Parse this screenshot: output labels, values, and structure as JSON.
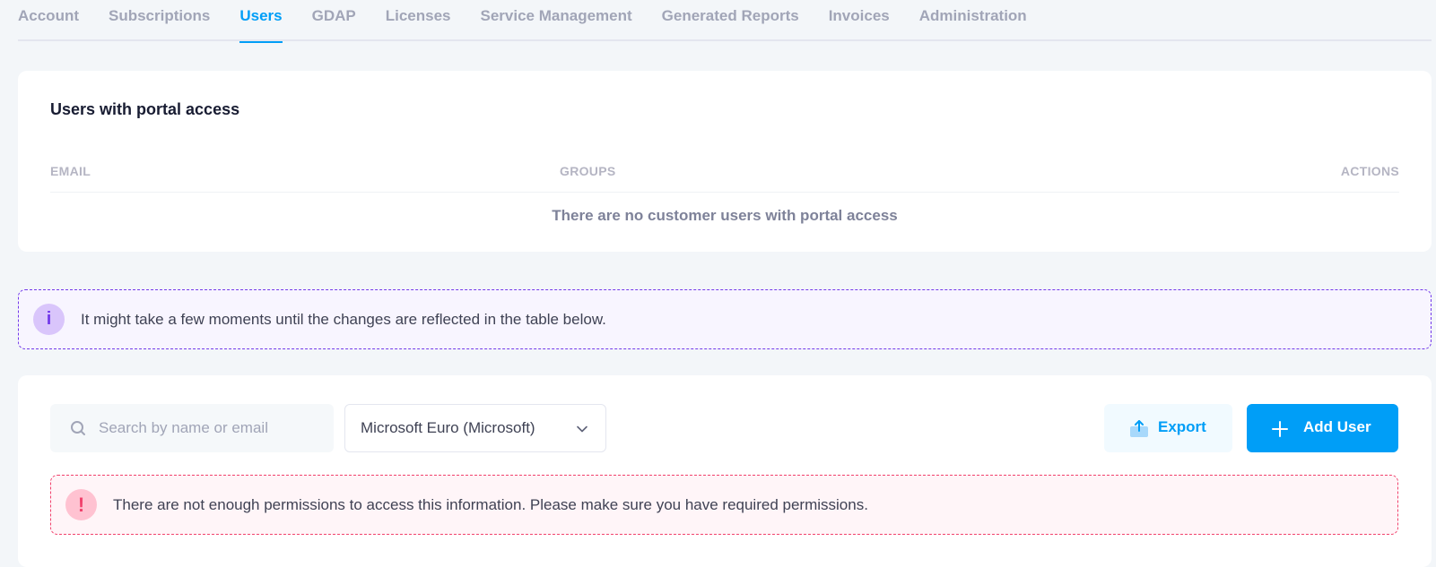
{
  "tabs": [
    {
      "label": "Account",
      "active": false
    },
    {
      "label": "Subscriptions",
      "active": false
    },
    {
      "label": "Users",
      "active": true
    },
    {
      "label": "GDAP",
      "active": false
    },
    {
      "label": "Licenses",
      "active": false
    },
    {
      "label": "Service Management",
      "active": false
    },
    {
      "label": "Generated Reports",
      "active": false
    },
    {
      "label": "Invoices",
      "active": false
    },
    {
      "label": "Administration",
      "active": false
    }
  ],
  "portal_users": {
    "title": "Users with portal access",
    "columns": {
      "email": "EMAIL",
      "groups": "GROUPS",
      "actions": "ACTIONS"
    },
    "empty_message": "There are no customer users with portal access"
  },
  "info_banner": {
    "icon": "info-icon",
    "text": "It might take a few moments until the changes are reflected in the table below."
  },
  "toolbar": {
    "search_placeholder": "Search by name or email",
    "search_value": "",
    "select_value": "Microsoft Euro (Microsoft)",
    "export_label": "Export",
    "add_user_label": "Add User"
  },
  "error_banner": {
    "icon": "exclamation-icon",
    "text": "There are not enough permissions to access this information. Please make sure you have required permissions."
  },
  "colors": {
    "primary": "#009ef7",
    "info": "#7239ea",
    "danger": "#f1416c",
    "background": "#f3f6f9"
  }
}
